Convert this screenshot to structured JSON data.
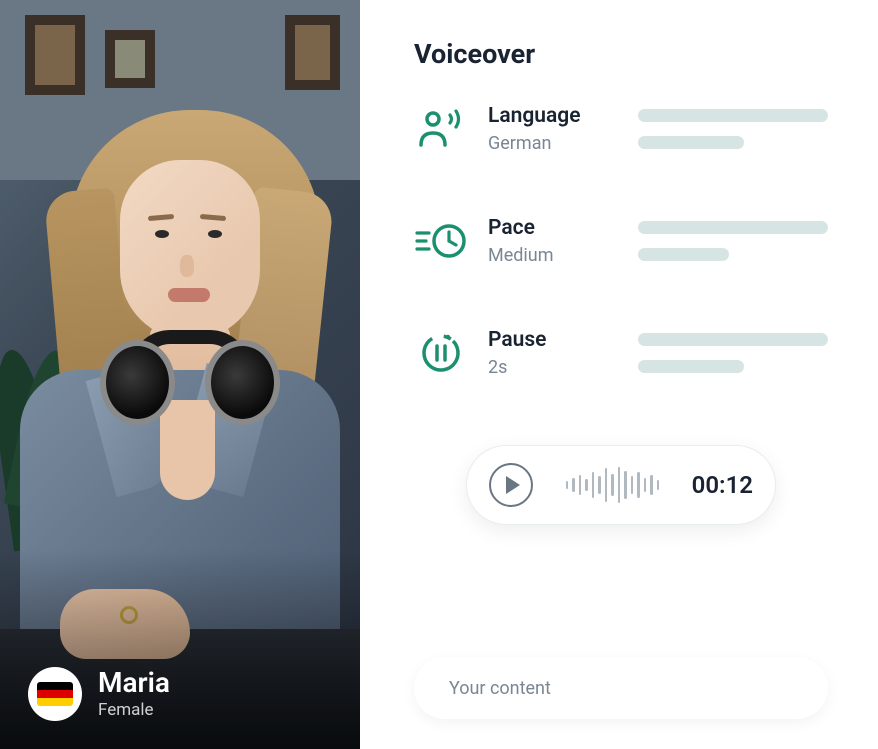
{
  "colors": {
    "accent": "#1b8f6e"
  },
  "voice": {
    "name": "Maria",
    "gender": "Female",
    "country_code": "DE"
  },
  "panel": {
    "title": "Voiceover"
  },
  "settings": {
    "language": {
      "label": "Language",
      "value": "German"
    },
    "pace": {
      "label": "Pace",
      "value": "Medium"
    },
    "pause": {
      "label": "Pause",
      "value": "2s"
    }
  },
  "player": {
    "time": "00:12"
  },
  "input": {
    "placeholder": "Your content"
  }
}
